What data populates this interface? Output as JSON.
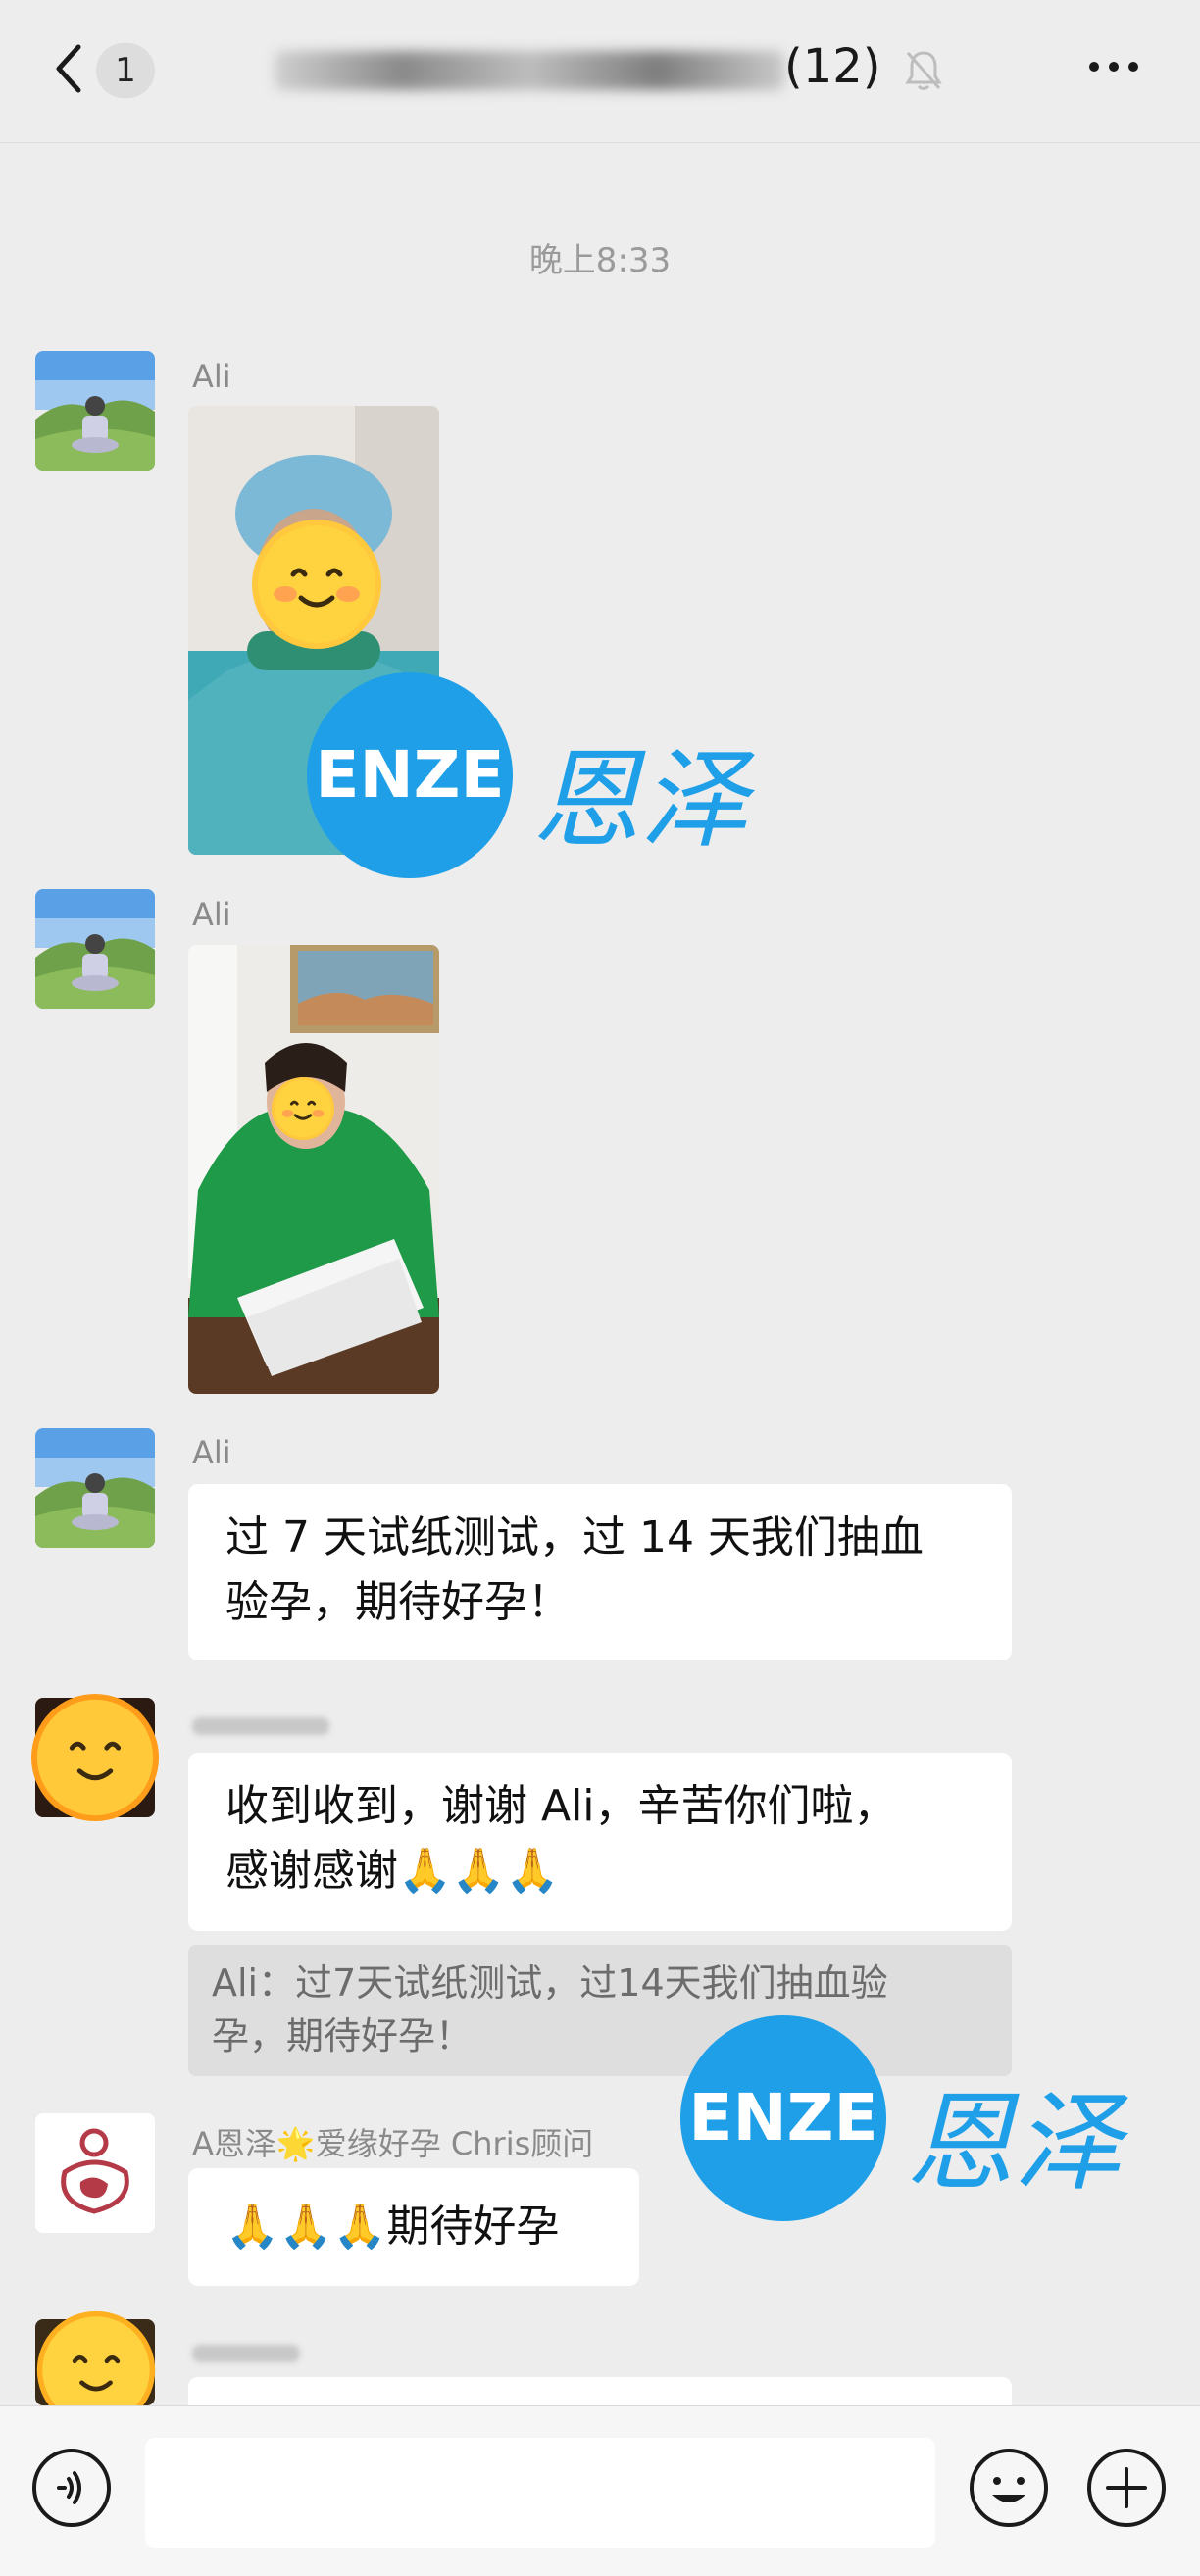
{
  "header": {
    "unread_count": "1",
    "group_title_suffix": "(12)"
  },
  "timestamp": "晚上8:33",
  "messages": [
    {
      "sender": "Ali",
      "type": "image"
    },
    {
      "sender": "Ali",
      "type": "image"
    },
    {
      "sender": "Ali",
      "type": "text",
      "lines": [
        "过 7 天试纸测试，过 14 天我们抽血",
        "验孕，期待好孕！"
      ]
    },
    {
      "sender": "",
      "type": "text",
      "lines": [
        "收到收到，谢谢 Ali，辛苦你们啦，",
        "感谢感谢🙏🙏🙏"
      ],
      "quote_lines": [
        "Ali：过7天试纸测试，过14天我们抽血验",
        "孕，期待好孕！"
      ]
    },
    {
      "sender": "A恩泽🌟爱缘好孕 Chris顾问",
      "type": "text",
      "lines": [
        "🙏🙏🙏期待好孕"
      ]
    }
  ],
  "watermark": {
    "en": "ENZE",
    "cn": "恩泽",
    "color": "#1e9fe8"
  },
  "input_bar": {
    "placeholder": ""
  },
  "icons": [
    "back-arrow-icon",
    "mute-bell-icon",
    "more-icon",
    "voice-icon",
    "emoji-icon",
    "plus-icon"
  ]
}
